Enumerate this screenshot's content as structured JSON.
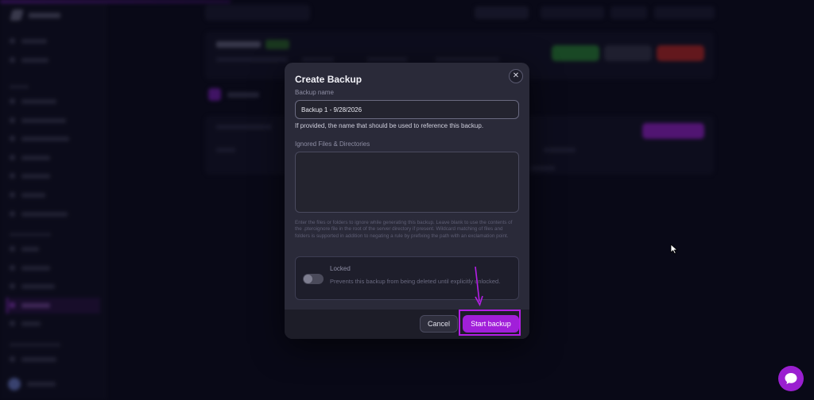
{
  "modal": {
    "title": "Create Backup",
    "backup_name_label": "Backup name",
    "backup_name_value": "Backup 1 - 9/28/2026",
    "backup_name_help": "If provided, the name that should be used to reference this backup.",
    "ignored_label": "Ignored Files & Directories",
    "ignored_value": "",
    "ignored_help": "Enter the files or folders to ignore while generating this backup. Leave blank to use the contents of the .pteroignore file in the root of the server directory if present. Wildcard matching of files and folders is supported in addition to negating a rule by prefixing the path with an exclamation point.",
    "locked_title": "Locked",
    "locked_desc": "Prevents this backup from being deleted until explicitly unlocked.",
    "locked_on": false,
    "cancel_label": "Cancel",
    "start_label": "Start backup"
  },
  "colors": {
    "accent": "#a11fd9",
    "modal_bg": "#2a2a39",
    "page_bg": "#0c0c1e",
    "highlight": "#b41ee6"
  },
  "icons": {
    "close": "close-icon",
    "chat": "chat-icon",
    "cursor": "mouse-cursor-icon",
    "annotation": "annotation-arrow"
  }
}
